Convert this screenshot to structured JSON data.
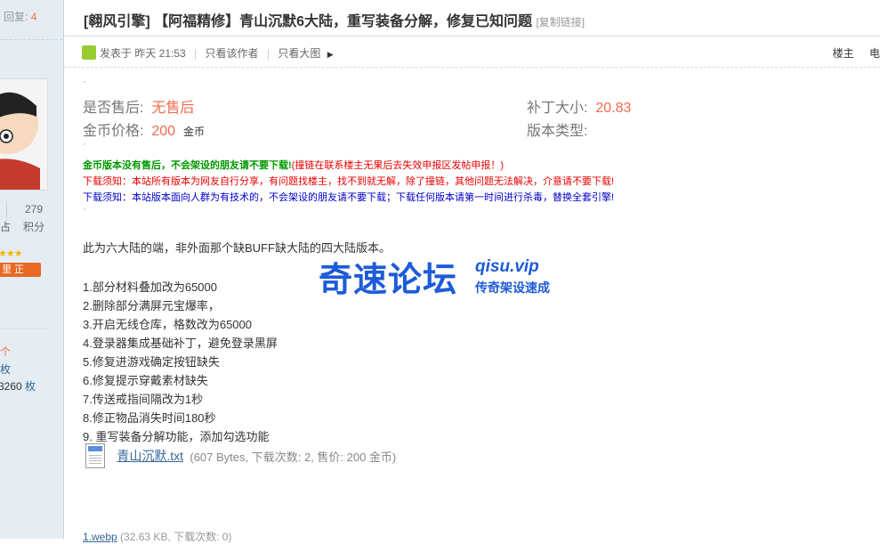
{
  "sidebar": {
    "reply_label": "回复:",
    "reply_count": "4",
    "stat_left_label": "占",
    "points_value": "279",
    "points_label": "积分",
    "stars": "★★★",
    "badge": "里 正",
    "line1": "个",
    "line2": "枚",
    "line3_value": "3260",
    "line3_unit": "枚"
  },
  "thread": {
    "title": "[翱风引擎] 【阿福精修】青山沉默6大陆，重写装备分解，修复已知问题",
    "copy_link": "[复制链接]"
  },
  "meta": {
    "posted": "发表于 昨天 21:53",
    "author_only": "只看该作者",
    "big_image_only": "只看大图",
    "floor_label": "楼主",
    "cut_label": "电"
  },
  "props": {
    "after_sales_label": "是否售后:",
    "after_sales_value": "无售后",
    "patch_size_label": "补丁大小:",
    "patch_size_value": "20.83",
    "price_label": "金币价格:",
    "price_value": "200",
    "price_unit": "金币",
    "version_type_label": "版本类型:"
  },
  "notices": {
    "n1_bold": "金币版本没有售后，不会架设的朋友请不要下载!",
    "n1_tail": "(撞链在联系楼主无果后去失效申报区发帖申报！)",
    "n2": "下载须知：本站所有版本为网友自行分享，有问题找楼主，找不到就无解，除了撞链，其他问题无法解决，介意请不要下载!",
    "n3": "下载须知：本站版本面向人群为有技术的，不会架设的朋友请不要下载；下载任何版本请第一时间进行杀毒，替换全套引擎!"
  },
  "content": {
    "intro": "此为六大陆的端，非外面那个缺BUFF缺大陆的四大陆版本。",
    "items": [
      "1.部分材料叠加改为65000",
      "2.删除部分满屏元宝爆率，",
      "3.开启无线仓库，格数改为65000",
      "4.登录器集成基础补丁，避免登录黑屏",
      "5.修复进游戏确定按钮缺失",
      "6.修复提示穿戴素材缺失",
      "7.传送戒指间隔改为1秒",
      "8.修正物品消失时间180秒",
      "9. 重写装备分解功能，添加勾选功能"
    ]
  },
  "watermark": {
    "big": "奇速论坛",
    "domain": "qisu.vip",
    "slogan": "传奇架设速成"
  },
  "attachment": {
    "filename": "青山沉默.txt",
    "meta": "(607 Bytes, 下载次数: 2, 售价: 200 金币)"
  },
  "bottom": {
    "link": "1.webp",
    "meta": "(32.63 KB, 下载次数: 0)"
  }
}
